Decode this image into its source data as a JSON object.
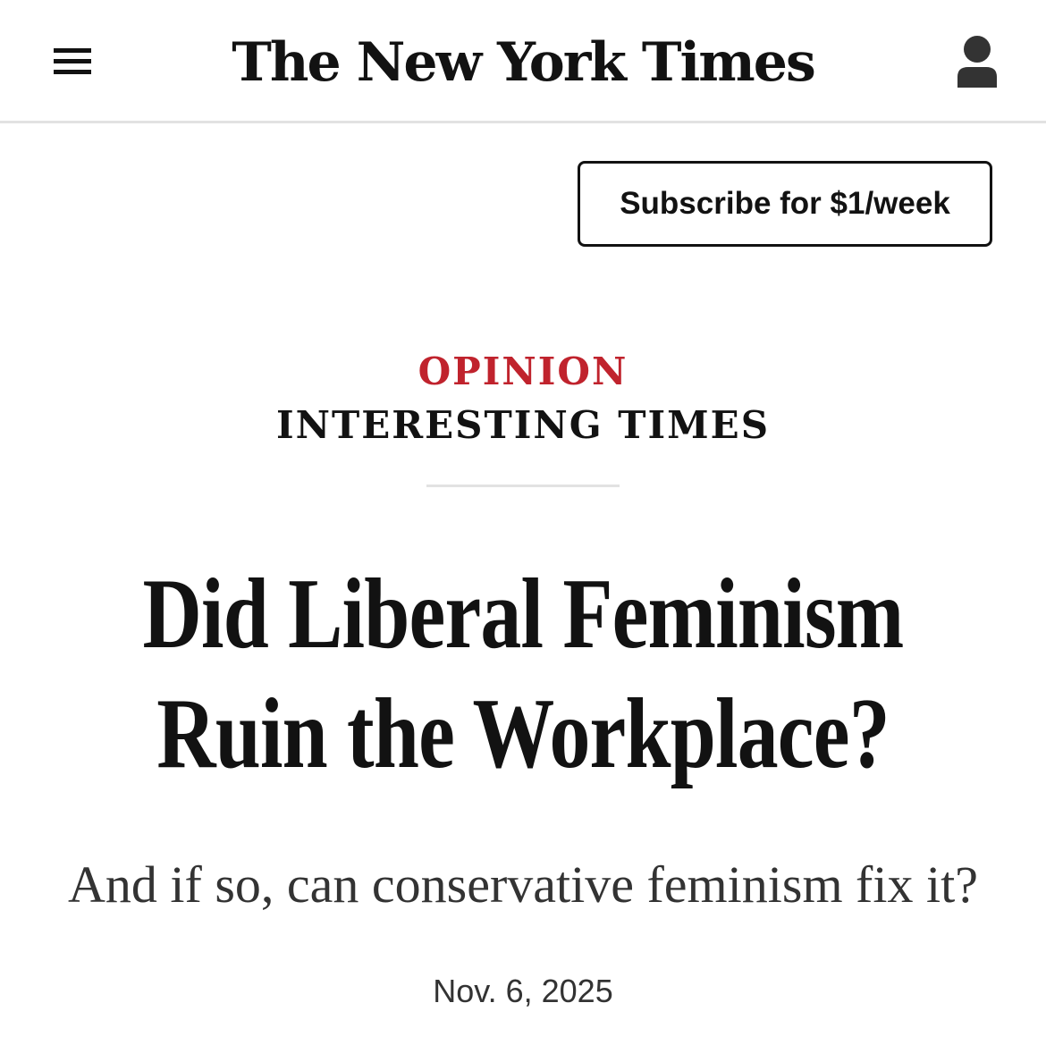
{
  "header": {
    "logo_text": "The New York Times",
    "menu_icon": "hamburger-menu-icon",
    "account_icon": "user-account-icon"
  },
  "subscribe": {
    "label": "Subscribe for $1/week"
  },
  "article": {
    "section": "OPINION",
    "column": "INTERESTING TIMES",
    "headline_line1": "Did Liberal Feminism",
    "headline_line2": "Ruin the Workplace?",
    "dek": "And if so, can conservative feminism fix it?",
    "date": "Nov. 6, 2025"
  },
  "colors": {
    "opinion_red": "#c0232d",
    "text": "#121212",
    "divider": "#e2e2e2"
  }
}
